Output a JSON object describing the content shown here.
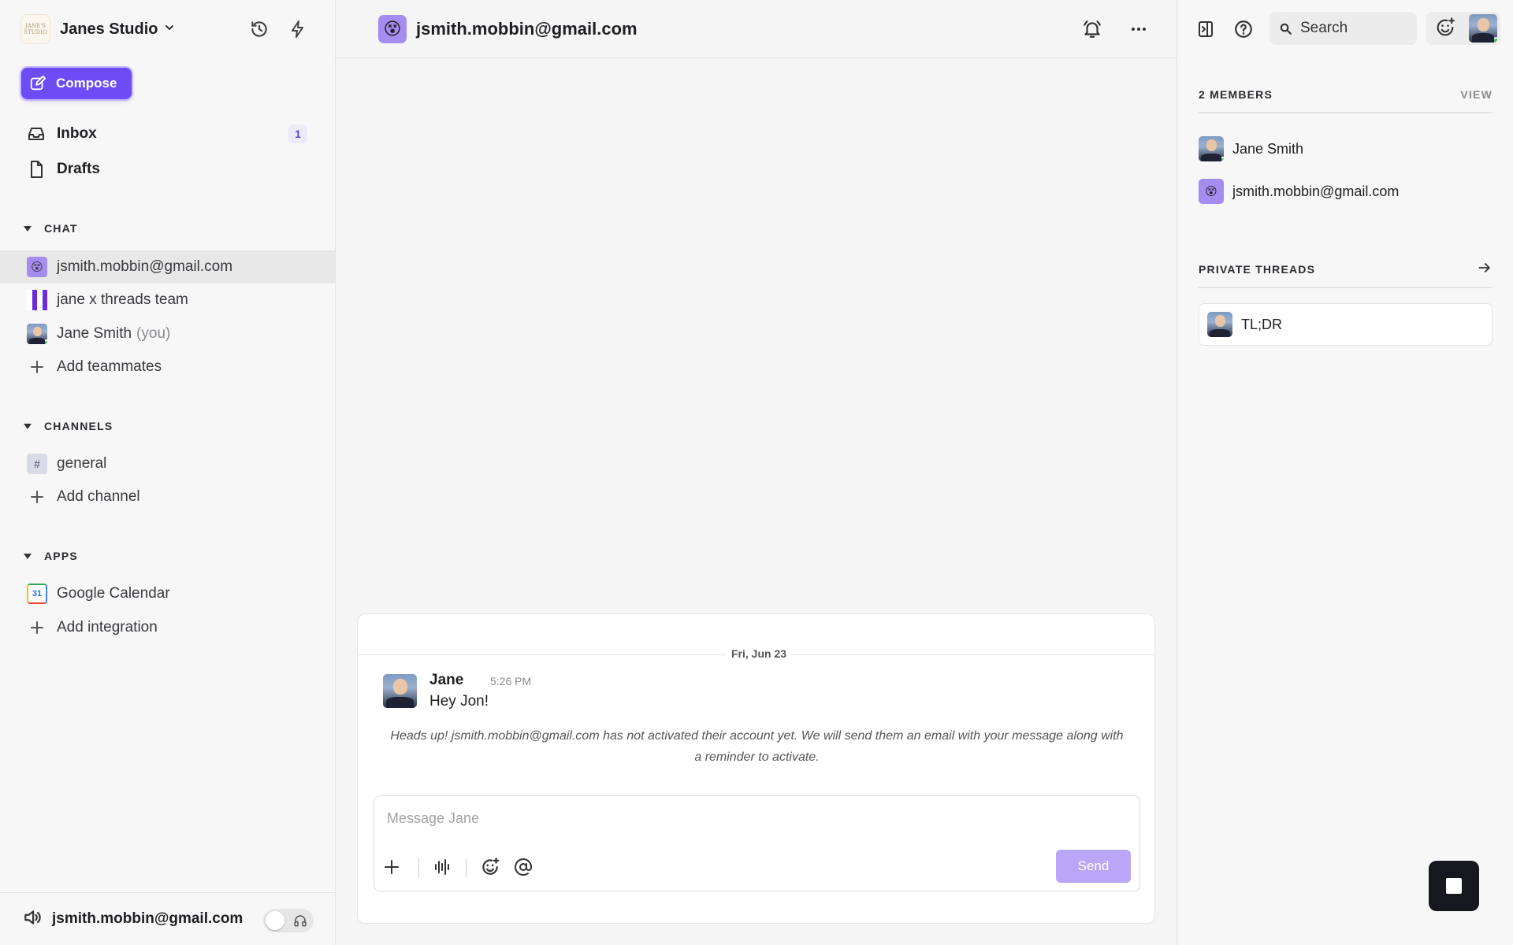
{
  "sidebar": {
    "workspace": {
      "name": "Janes Studio",
      "logo_text": "JANE'S STUDIO"
    },
    "compose_label": "Compose",
    "nav": [
      {
        "label": "Inbox",
        "badge": "1"
      },
      {
        "label": "Drafts"
      }
    ],
    "sections": {
      "chat": {
        "title": "CHAT",
        "items": [
          {
            "label": "jsmith.mobbin@gmail.com",
            "avatar_emoji": "😵"
          },
          {
            "label": "jane x threads team"
          },
          {
            "label": "Jane Smith",
            "suffix": "(you)"
          }
        ],
        "add_label": "Add teammates"
      },
      "channels": {
        "title": "CHANNELS",
        "items": [
          {
            "label": "general",
            "prefix": "#"
          }
        ],
        "add_label": "Add channel"
      },
      "apps": {
        "title": "APPS",
        "items": [
          {
            "label": "Google Calendar",
            "icon_text": "31"
          }
        ],
        "add_label": "Add integration"
      }
    },
    "footer": {
      "email": "jsmith.mobbin@gmail.com"
    }
  },
  "main": {
    "header": {
      "title": "jsmith.mobbin@gmail.com",
      "avatar_emoji": "😵"
    },
    "conversation": {
      "date": "Fri, Jun 23",
      "message": {
        "author": "Jane",
        "time": "5:26 PM",
        "text": "Hey Jon!"
      },
      "notice": "Heads up! jsmith.mobbin@gmail.com has not activated their account yet. We will send them an email with your message along with a reminder to activate."
    },
    "composer": {
      "placeholder": "Message Jane",
      "send_label": "Send"
    }
  },
  "right_panel": {
    "search_label": "Search",
    "members": {
      "title": "2 MEMBERS",
      "action": "VIEW",
      "list": [
        {
          "name": "Jane Smith"
        },
        {
          "name": "jsmith.mobbin@gmail.com",
          "avatar_emoji": "😵"
        }
      ]
    },
    "private_threads": {
      "title": "PRIVATE THREADS",
      "items": [
        {
          "label": "TL;DR"
        }
      ]
    }
  },
  "colors": {
    "accent": "#6c4cf5",
    "send_disabled": "#b9a6f7",
    "online": "#3fbf5f",
    "badge_bg": "#ecebfb"
  }
}
